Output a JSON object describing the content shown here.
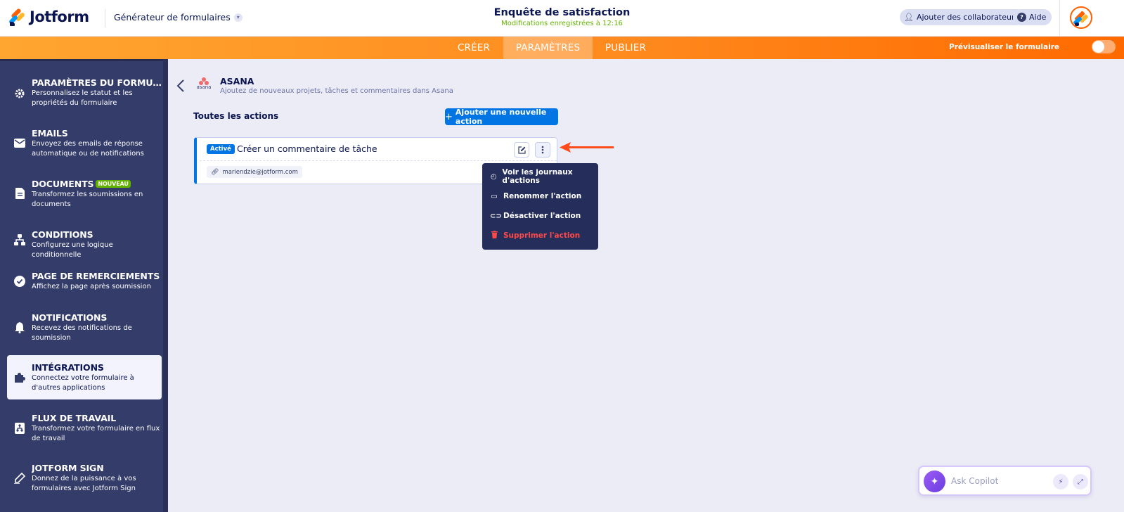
{
  "header": {
    "brand": "Jotform",
    "builder_menu": "Générateur de formulaires",
    "form_title": "Enquête de satisfaction",
    "save_status": "Modifications enregistrées à 12:16",
    "collaborators_label": "Ajouter des collaborateurs",
    "help_label": "Aide"
  },
  "nav": {
    "tabs": [
      {
        "label": "CRÉER"
      },
      {
        "label": "PARAMÈTRES"
      },
      {
        "label": "PUBLIER"
      }
    ],
    "active_tab": "PARAMÈTRES",
    "preview_label": "Prévisualiser le formulaire",
    "preview_enabled": false
  },
  "sidebar": {
    "items": [
      {
        "title": "PARAMÈTRES DU FORMULAI...",
        "desc": "Personnalisez le statut et les propriétés du formulaire",
        "icon": "gear-icon"
      },
      {
        "title": "EMAILS",
        "desc": "Envoyez des emails de réponse automatique ou de notifications",
        "icon": "envelope-icon"
      },
      {
        "title": "DOCUMENTS",
        "badge": "NOUVEAU",
        "desc": "Transformez les soumissions en documents",
        "icon": "document-icon"
      },
      {
        "title": "CONDITIONS",
        "desc": "Configurez une logique conditionnelle",
        "icon": "flow-icon"
      },
      {
        "title": "PAGE DE REMERCIEMENTS",
        "desc": "Affichez la page après soumission",
        "icon": "check-circle-icon"
      },
      {
        "title": "NOTIFICATIONS",
        "desc": "Recevez des notifications de soumission",
        "icon": "bell-icon"
      },
      {
        "title": "INTÉGRATIONS",
        "desc": "Connectez votre formulaire à d'autres applications",
        "icon": "puzzle-icon"
      },
      {
        "title": "FLUX DE TRAVAIL",
        "desc": "Transformez votre formulaire en flux de travail",
        "icon": "workflow-icon"
      },
      {
        "title": "JOTFORM SIGN",
        "desc": "Donnez de la puissance à vos formulaires avec Jotform Sign",
        "icon": "pen-icon"
      }
    ],
    "active_index": 6
  },
  "integration": {
    "logo_text": "asana",
    "name": "ASANA",
    "description": "Ajoutez de nouveaux projets, tâches et commentaires dans Asana"
  },
  "actions": {
    "heading": "Toutes les actions",
    "add_button": "Ajouter une nouvelle action",
    "items": [
      {
        "status": "Activé",
        "title": "Créer un commentaire de tâche",
        "account": "mariendzie@jotform.com"
      }
    ]
  },
  "context_menu": {
    "items": [
      {
        "label": "Voir les journaux d'actions",
        "icon": "history-icon"
      },
      {
        "label": "Renommer l'action",
        "icon": "rename-icon"
      },
      {
        "label": "Désactiver l'action",
        "icon": "toggle-icon"
      },
      {
        "label": "Supprimer l'action",
        "icon": "trash-icon",
        "danger": true
      }
    ]
  },
  "copilot": {
    "placeholder": "Ask Copilot"
  },
  "colors": {
    "accent_orange": "#ff6100",
    "primary_blue": "#0075e3",
    "sidebar_bg": "#343c6a",
    "danger": "#ff4948",
    "success": "#64b200"
  }
}
